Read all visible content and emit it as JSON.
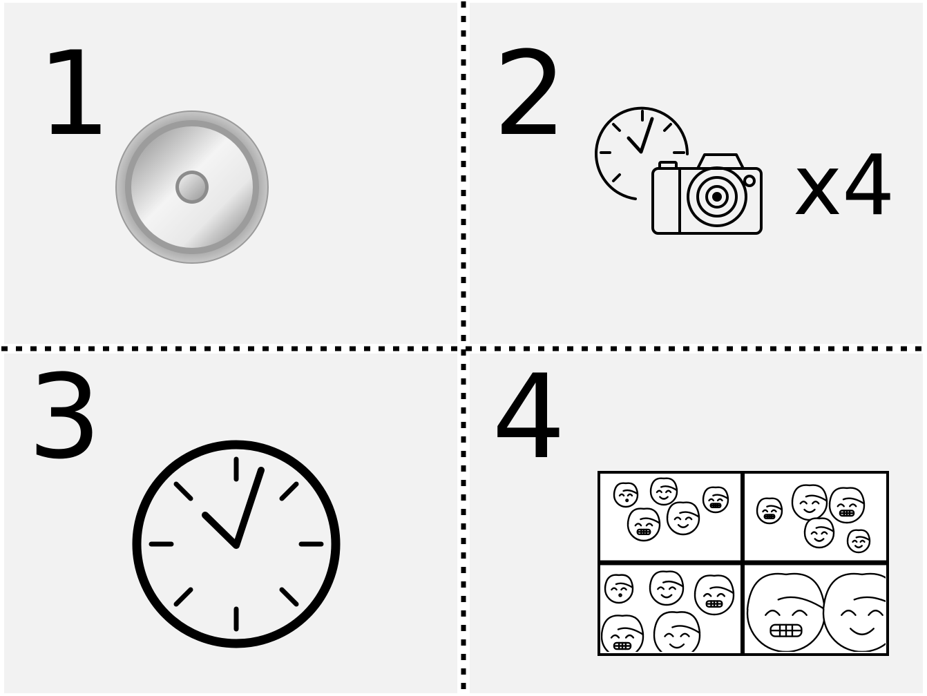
{
  "steps": [
    {
      "number": "1",
      "icon": "button-icon"
    },
    {
      "number": "2",
      "icon": "timer-camera-icon",
      "multiplier": "x4"
    },
    {
      "number": "3",
      "icon": "clock-icon"
    },
    {
      "number": "4",
      "icon": "photo-collage-icon"
    }
  ],
  "colors": {
    "panel_background": "#f2f2f2",
    "divider": "#000000",
    "ink": "#000000",
    "button_metal": "#b0b0b0"
  }
}
